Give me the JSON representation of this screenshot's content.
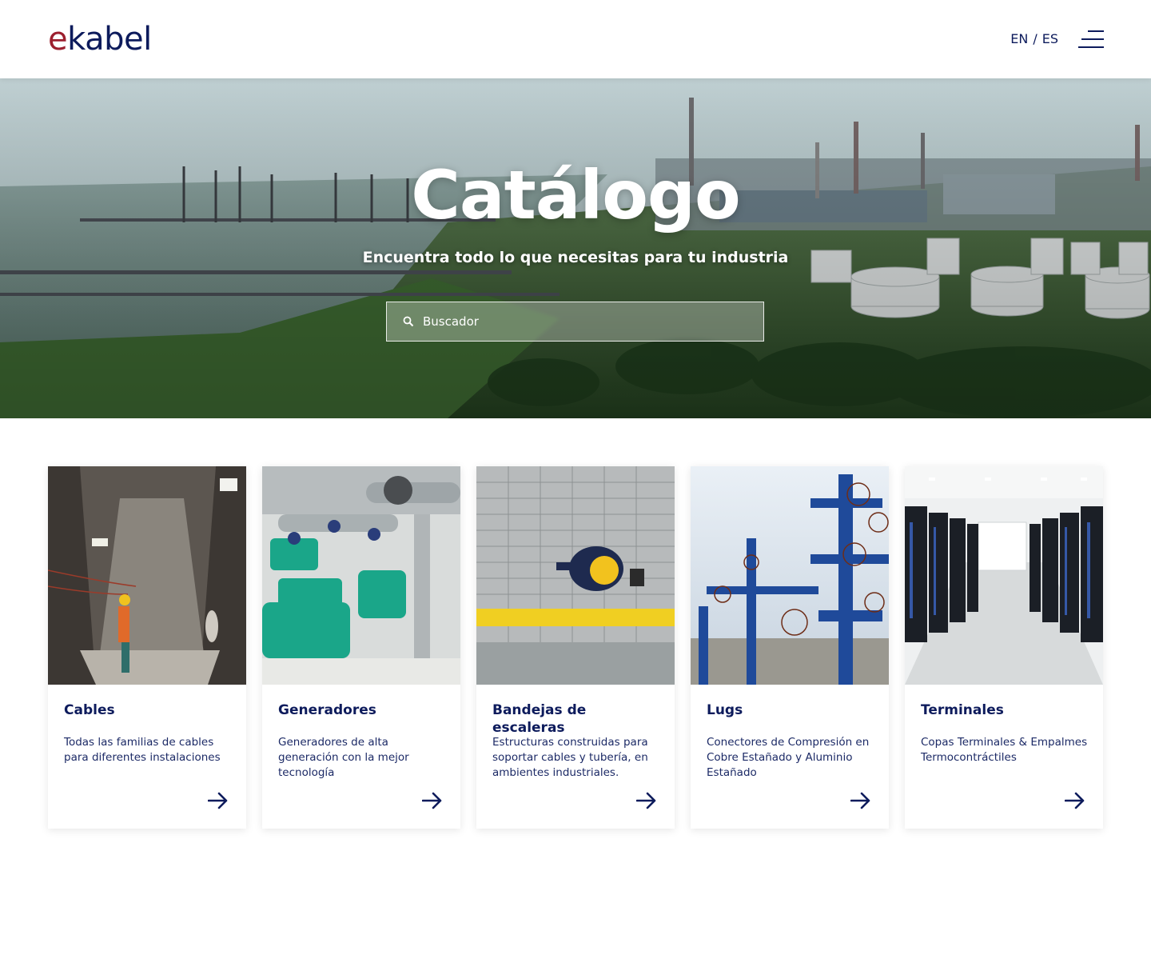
{
  "header": {
    "logo_e": "e",
    "logo_rest": "kabel",
    "lang_en": "EN",
    "lang_sep": "/",
    "lang_es": "ES",
    "menu_icon": "hamburger-menu-icon"
  },
  "hero": {
    "title": "Catálogo",
    "subtitle": "Encuentra todo lo que necesitas para tu industria",
    "search_placeholder": "Buscador",
    "search_value": "",
    "search_icon": "search-icon"
  },
  "cards": [
    {
      "title": "Cables",
      "description": "Todas las familias de cables para diferentes instalaciones",
      "image": "tunnel-worker-image",
      "arrow_icon": "arrow-right-icon"
    },
    {
      "title": "Generadores",
      "description": "Generadores de alta generación con la mejor tecnología",
      "image": "pump-generators-image",
      "arrow_icon": "arrow-right-icon"
    },
    {
      "title": "Bandejas de escaleras",
      "description": "Estructuras construidas para soportar cables y tubería, en ambientes industriales.",
      "image": "cable-tray-worker-image",
      "arrow_icon": "arrow-right-icon"
    },
    {
      "title": "Lugs",
      "description": "Conectores de Compresión en Cobre Estañado y Aluminio Estañado",
      "image": "wellhead-valves-image",
      "arrow_icon": "arrow-right-icon"
    },
    {
      "title": "Terminales",
      "description": "Copas Terminales & Empalmes Termocontráctiles",
      "image": "server-room-image",
      "arrow_icon": "arrow-right-icon"
    }
  ],
  "colors": {
    "brand_navy": "#0d1b5c",
    "brand_red": "#9c1f2e",
    "white": "#ffffff"
  }
}
